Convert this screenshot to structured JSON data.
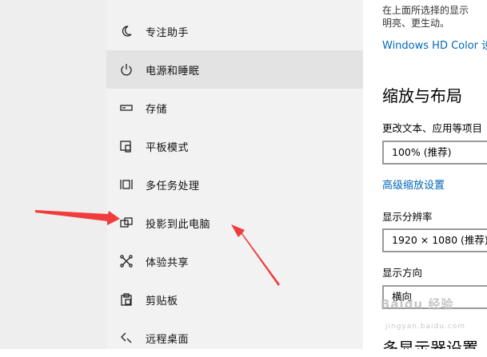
{
  "sidebar": {
    "items": [
      {
        "label": "专注助手",
        "icon": "moon-icon"
      },
      {
        "label": "电源和睡眠",
        "icon": "power-icon"
      },
      {
        "label": "存储",
        "icon": "storage-icon"
      },
      {
        "label": "平板模式",
        "icon": "tablet-mode-icon"
      },
      {
        "label": "多任务处理",
        "icon": "multitasking-icon"
      },
      {
        "label": "投影到此电脑",
        "icon": "project-icon"
      },
      {
        "label": "体验共享",
        "icon": "shared-experiences-icon"
      },
      {
        "label": "剪贴板",
        "icon": "clipboard-icon"
      },
      {
        "label": "远程桌面",
        "icon": "remote-desktop-icon"
      }
    ],
    "selected_index": 1
  },
  "content": {
    "hdr_desc_line1": "在上面所选择的显示",
    "hdr_desc_line2": "明亮、更生动。",
    "hdr_link": "Windows HD Color 设",
    "scale_layout_title": "缩放与布局",
    "change_size_label": "更改文本、应用等项目",
    "scale_value": "100% (推荐)",
    "advanced_scaling_link": "高级缩放设置",
    "resolution_label": "显示分辨率",
    "resolution_value": "1920 × 1080 (推荐)",
    "orientation_label": "显示方向",
    "orientation_value": "横向",
    "multi_display_title": "多显示器设置"
  },
  "watermark": {
    "text": "Baidu 经验",
    "sub": "jingyan.baidu.com"
  },
  "colors": {
    "link": "#0067b8",
    "annotation_arrow": "#f03c3c",
    "selected_bg": "#e3e3e3"
  }
}
